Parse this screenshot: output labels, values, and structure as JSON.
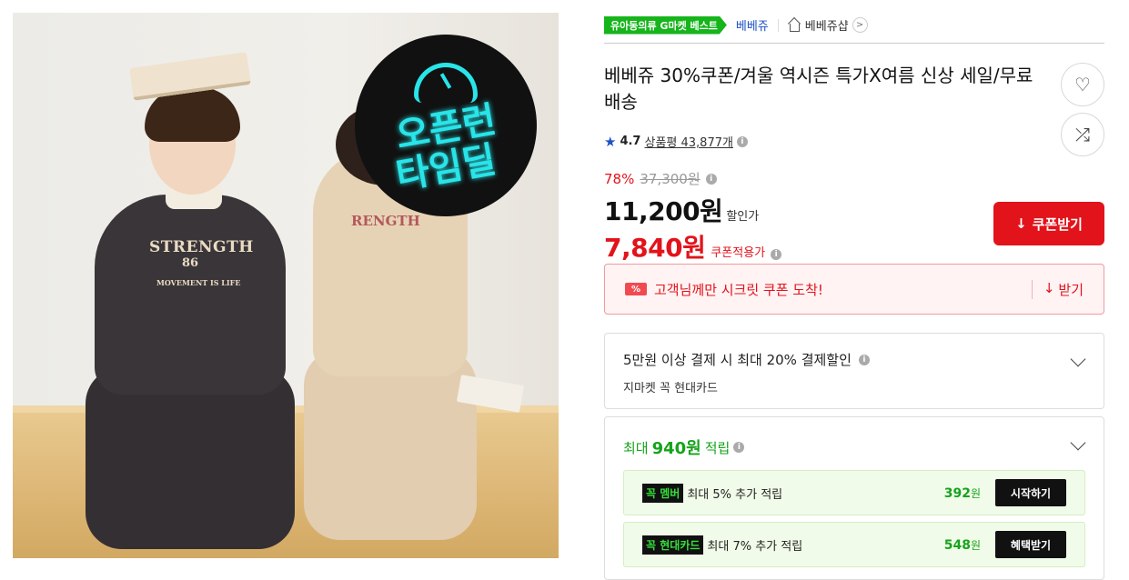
{
  "image": {
    "badge_line1": "오픈런",
    "badge_line2": "타임딜",
    "print_kid1_line1": "STRENGTH",
    "print_kid1_line2": "86",
    "print_kid1_line3": "MOVEMENT IS LIFE",
    "print_kid2": "RENGTH"
  },
  "topbar": {
    "best_tag": "유아동의류 G마켓 베스트",
    "store_link": "베베쥬",
    "shop_name": "베베쥬샵",
    "shop_arrow": ">"
  },
  "product": {
    "title": "베베쥬 30%쿠폰/겨울 역시즌 특가X여름 신상 세일/무료배송",
    "rating": "4.7",
    "review_label": "상품평 43,877개",
    "discount_rate": "78%",
    "original_price": "37,300원",
    "sale_price": "11,200원",
    "sale_price_label": "할인가",
    "coupon_price": "7,840원",
    "coupon_price_label": "쿠폰적용가"
  },
  "actions": {
    "heart": "♡",
    "share": "⤮",
    "coupon_button": "쿠폰받기"
  },
  "secret_coupon": {
    "tag": "%",
    "text": "고객님께만 시크릿 쿠폰 도착!",
    "get": "받기"
  },
  "card_discount": {
    "heading": "5만원 이상 결제 시 최대 20% 결제할인",
    "sub": "지마켓 꼭 현대카드"
  },
  "card_points": {
    "prefix": "최대",
    "amount": "940원",
    "suffix": "적립",
    "rows": [
      {
        "tag": "꼭",
        "tag2": "멤버",
        "desc": "최대 5% 추가 적립",
        "amount": "392",
        "unit": "원",
        "button": "시작하기"
      },
      {
        "tag": "꼭",
        "tag2": "현대카드",
        "desc": "최대 7% 추가 적립",
        "amount": "548",
        "unit": "원",
        "button": "혜택받기"
      }
    ]
  },
  "colors": {
    "accent_red": "#e2131b",
    "gmarket_green": "#16b51b",
    "link_blue": "#1c52c4",
    "neon_cyan": "#29e4e8"
  }
}
